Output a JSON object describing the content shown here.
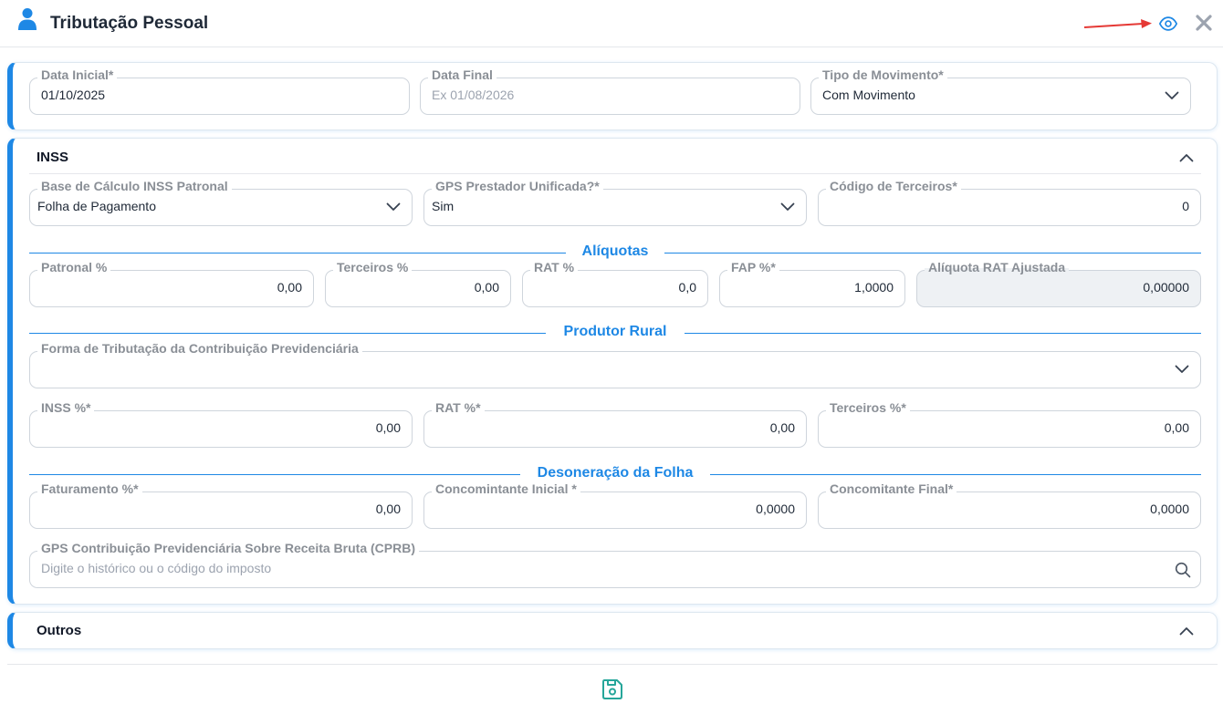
{
  "header": {
    "title": "Tributação Pessoal",
    "icons": [
      "user-icon",
      "eye-icon",
      "close-icon"
    ]
  },
  "period": {
    "data_inicial": {
      "label": "Data Inicial*",
      "value": "01/10/2025"
    },
    "data_final": {
      "label": "Data Final",
      "placeholder": "Ex 01/08/2026"
    },
    "tipo_movimento": {
      "label": "Tipo de Movimento*",
      "value": "Com Movimento"
    }
  },
  "inss": {
    "title": "INSS",
    "base_calculo": {
      "label": "Base de Cálculo INSS Patronal",
      "value": "Folha de Pagamento"
    },
    "gps_prestador": {
      "label": "GPS Prestador Unificada?*",
      "value": "Sim"
    },
    "codigo_terceiros": {
      "label": "Código de Terceiros*",
      "value": "0"
    },
    "aliquotas": {
      "title": "Alíquotas",
      "patronal": {
        "label": "Patronal %",
        "value": "0,00"
      },
      "terceiros": {
        "label": "Terceiros %",
        "value": "0,00"
      },
      "rat": {
        "label": "RAT %",
        "value": "0,0"
      },
      "fap": {
        "label": "FAP %*",
        "value": "1,0000"
      },
      "rat_ajustada": {
        "label": "Alíquota RAT Ajustada",
        "value": "0,00000"
      }
    },
    "produtor_rural": {
      "title": "Produtor Rural",
      "forma_tributacao": {
        "label": "Forma de Tributação da Contribuição Previdenciária",
        "value": ""
      },
      "inss_pct": {
        "label": "INSS %*",
        "value": "0,00"
      },
      "rat_pct": {
        "label": "RAT %*",
        "value": "0,00"
      },
      "terceiros_pct": {
        "label": "Terceiros %*",
        "value": "0,00"
      }
    },
    "desoneracao": {
      "title": "Desoneração da Folha",
      "faturamento": {
        "label": "Faturamento %*",
        "value": "0,00"
      },
      "concomitante_inicial": {
        "label": "Concomintante Inicial *",
        "value": "0,0000"
      },
      "concomitante_final": {
        "label": "Concomitante Final*",
        "value": "0,0000"
      },
      "gps_cprb": {
        "label": "GPS Contribuição Previdenciária Sobre Receita Bruta (CPRB)",
        "placeholder": "Digite o histórico ou o código do imposto"
      }
    }
  },
  "outros": {
    "title": "Outros"
  },
  "colors": {
    "accent": "#1e88e5",
    "save": "#26a69a",
    "arrow": "#e53935"
  }
}
